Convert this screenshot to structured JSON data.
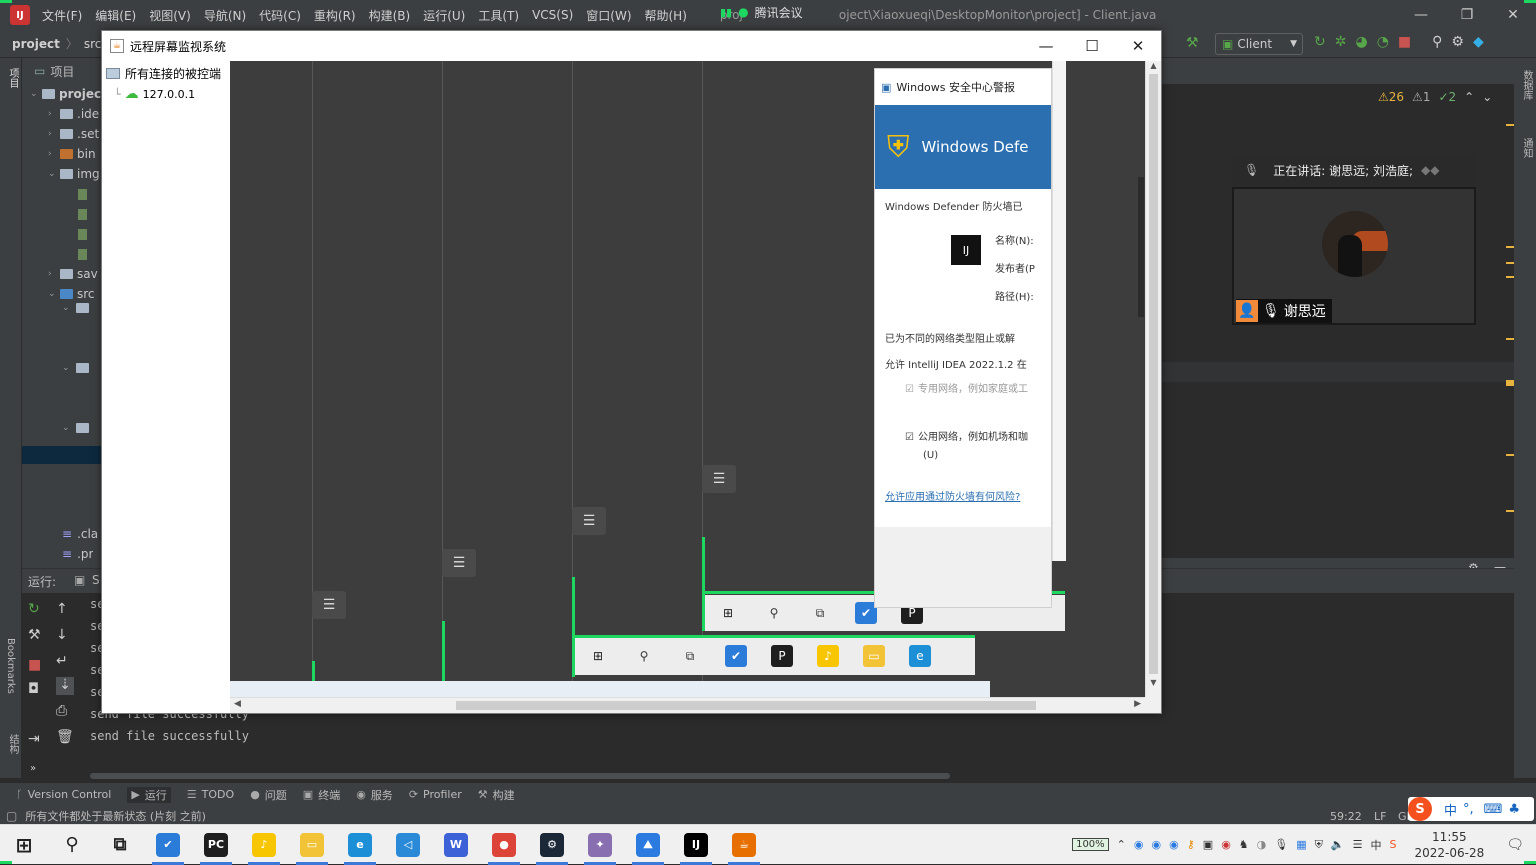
{
  "ide": {
    "menu": [
      "文件(F)",
      "编辑(E)",
      "视图(V)",
      "导航(N)",
      "代码(C)",
      "重构(R)",
      "构建(B)",
      "运行(U)",
      "工具(T)",
      "VCS(S)",
      "窗口(W)",
      "帮助(H)"
    ],
    "title_left": "proj",
    "title_path": "oject\\Xiaoxueqi\\DesktopMonitor\\project] - Client.java",
    "breadcrumb": [
      "project",
      "src"
    ],
    "run_config": "Client",
    "inspections": {
      "warnings": "26",
      "weak": "1",
      "typos": "2"
    },
    "left_strip_labels": [
      "项目",
      "Bookmarks",
      "结构"
    ],
    "right_strip_labels": [
      "数据库",
      "通知"
    ],
    "project_header": "项目",
    "tree": [
      {
        "label": "projec",
        "type": "folder",
        "indent": 0
      },
      {
        "label": ".ide",
        "type": "folder",
        "indent": 1
      },
      {
        "label": ".set",
        "type": "folder",
        "indent": 1
      },
      {
        "label": "bin",
        "type": "folder-orange",
        "indent": 1
      },
      {
        "label": "img",
        "type": "folder",
        "indent": 1
      },
      {
        "label": "",
        "type": "file",
        "indent": 2
      },
      {
        "label": "",
        "type": "file",
        "indent": 2
      },
      {
        "label": "",
        "type": "file",
        "indent": 2
      },
      {
        "label": "",
        "type": "file",
        "indent": 2
      },
      {
        "label": "sav",
        "type": "folder",
        "indent": 1
      },
      {
        "label": "src",
        "type": "folder",
        "indent": 1
      }
    ],
    "tree_bottom": [
      ".cla",
      ".pr"
    ],
    "run_header": "运行:",
    "run_tab": "S",
    "run_output": [
      "se",
      "se",
      "se",
      "se",
      "se",
      "send file successfully",
      "send file successfully"
    ],
    "tool_tabs": [
      "Version Control",
      "运行",
      "TODO",
      "问题",
      "终端",
      "服务",
      "Profiler",
      "构建"
    ],
    "status_left": "所有文件都处于最新状态 (片刻 之前)",
    "status_right": {
      "pos": "59:22",
      "eol": "LF",
      "enc": "GI"
    }
  },
  "meeting": {
    "app_name": "腾讯会议",
    "speaking_label": "正在讲话: 谢思远; 刘浩庭;",
    "participant_name": "谢思远"
  },
  "java_window": {
    "title": "远程屏幕监视系统",
    "tree_root": "所有连接的被控端",
    "tree_child": "127.0.0.1",
    "defender": {
      "header": "Windows 安全中心警报",
      "banner": "Windows Defe",
      "line1": "Windows Defender 防火墙已",
      "name_label": "名称(N):",
      "publisher_label": "发布者(P",
      "path_label": "路径(H):",
      "blocked": "已为不同的网络类型阻止或解",
      "allow": "允许 IntelliJ IDEA 2022.1.2 在",
      "private": "专用网络，例如家庭或工",
      "public": "公用网络，例如机场和咖",
      "public2": "(U)",
      "link": "允许应用通过防火墙有何风险?"
    }
  },
  "taskbar": {
    "apps": [
      {
        "name": "start",
        "icon": "windows-start-icon"
      },
      {
        "name": "search",
        "icon": "search-icon"
      },
      {
        "name": "taskview",
        "icon": "task-view-icon"
      },
      {
        "name": "todo",
        "icon": "todo-app-icon",
        "color": "#2b7bd8",
        "glyph": "✔"
      },
      {
        "name": "pycharm",
        "icon": "pycharm-icon",
        "color": "#1e1e1e",
        "glyph": "PC"
      },
      {
        "name": "qqmusic",
        "icon": "qq-music-icon",
        "color": "#f7c600",
        "glyph": "♪"
      },
      {
        "name": "explorer",
        "icon": "file-explorer-icon",
        "color": "#f2c237",
        "glyph": "▭"
      },
      {
        "name": "edge",
        "icon": "edge-icon",
        "color": "#1d8fd6",
        "glyph": "e"
      },
      {
        "name": "vscode",
        "icon": "vscode-icon",
        "color": "#2a8ad8",
        "glyph": "◁"
      },
      {
        "name": "wps",
        "icon": "wps-icon",
        "color": "#3d62d8",
        "glyph": "W"
      },
      {
        "name": "chrome",
        "icon": "chrome-icon",
        "color": "#db4437",
        "glyph": "●"
      },
      {
        "name": "steam",
        "icon": "steam-icon",
        "color": "#1b2838",
        "glyph": "⚙"
      },
      {
        "name": "game",
        "icon": "game-icon",
        "color": "#8a6fb0",
        "glyph": "✦"
      },
      {
        "name": "photos",
        "icon": "photos-icon",
        "color": "#2a7ae0",
        "glyph": "⛰"
      },
      {
        "name": "intellij",
        "icon": "intellij-icon",
        "color": "#000000",
        "glyph": "IJ"
      },
      {
        "name": "java",
        "icon": "java-icon",
        "color": "#e76f00",
        "glyph": "☕"
      }
    ],
    "battery": "100%",
    "ime": "中",
    "time": "11:55",
    "date": "2022-06-28"
  }
}
